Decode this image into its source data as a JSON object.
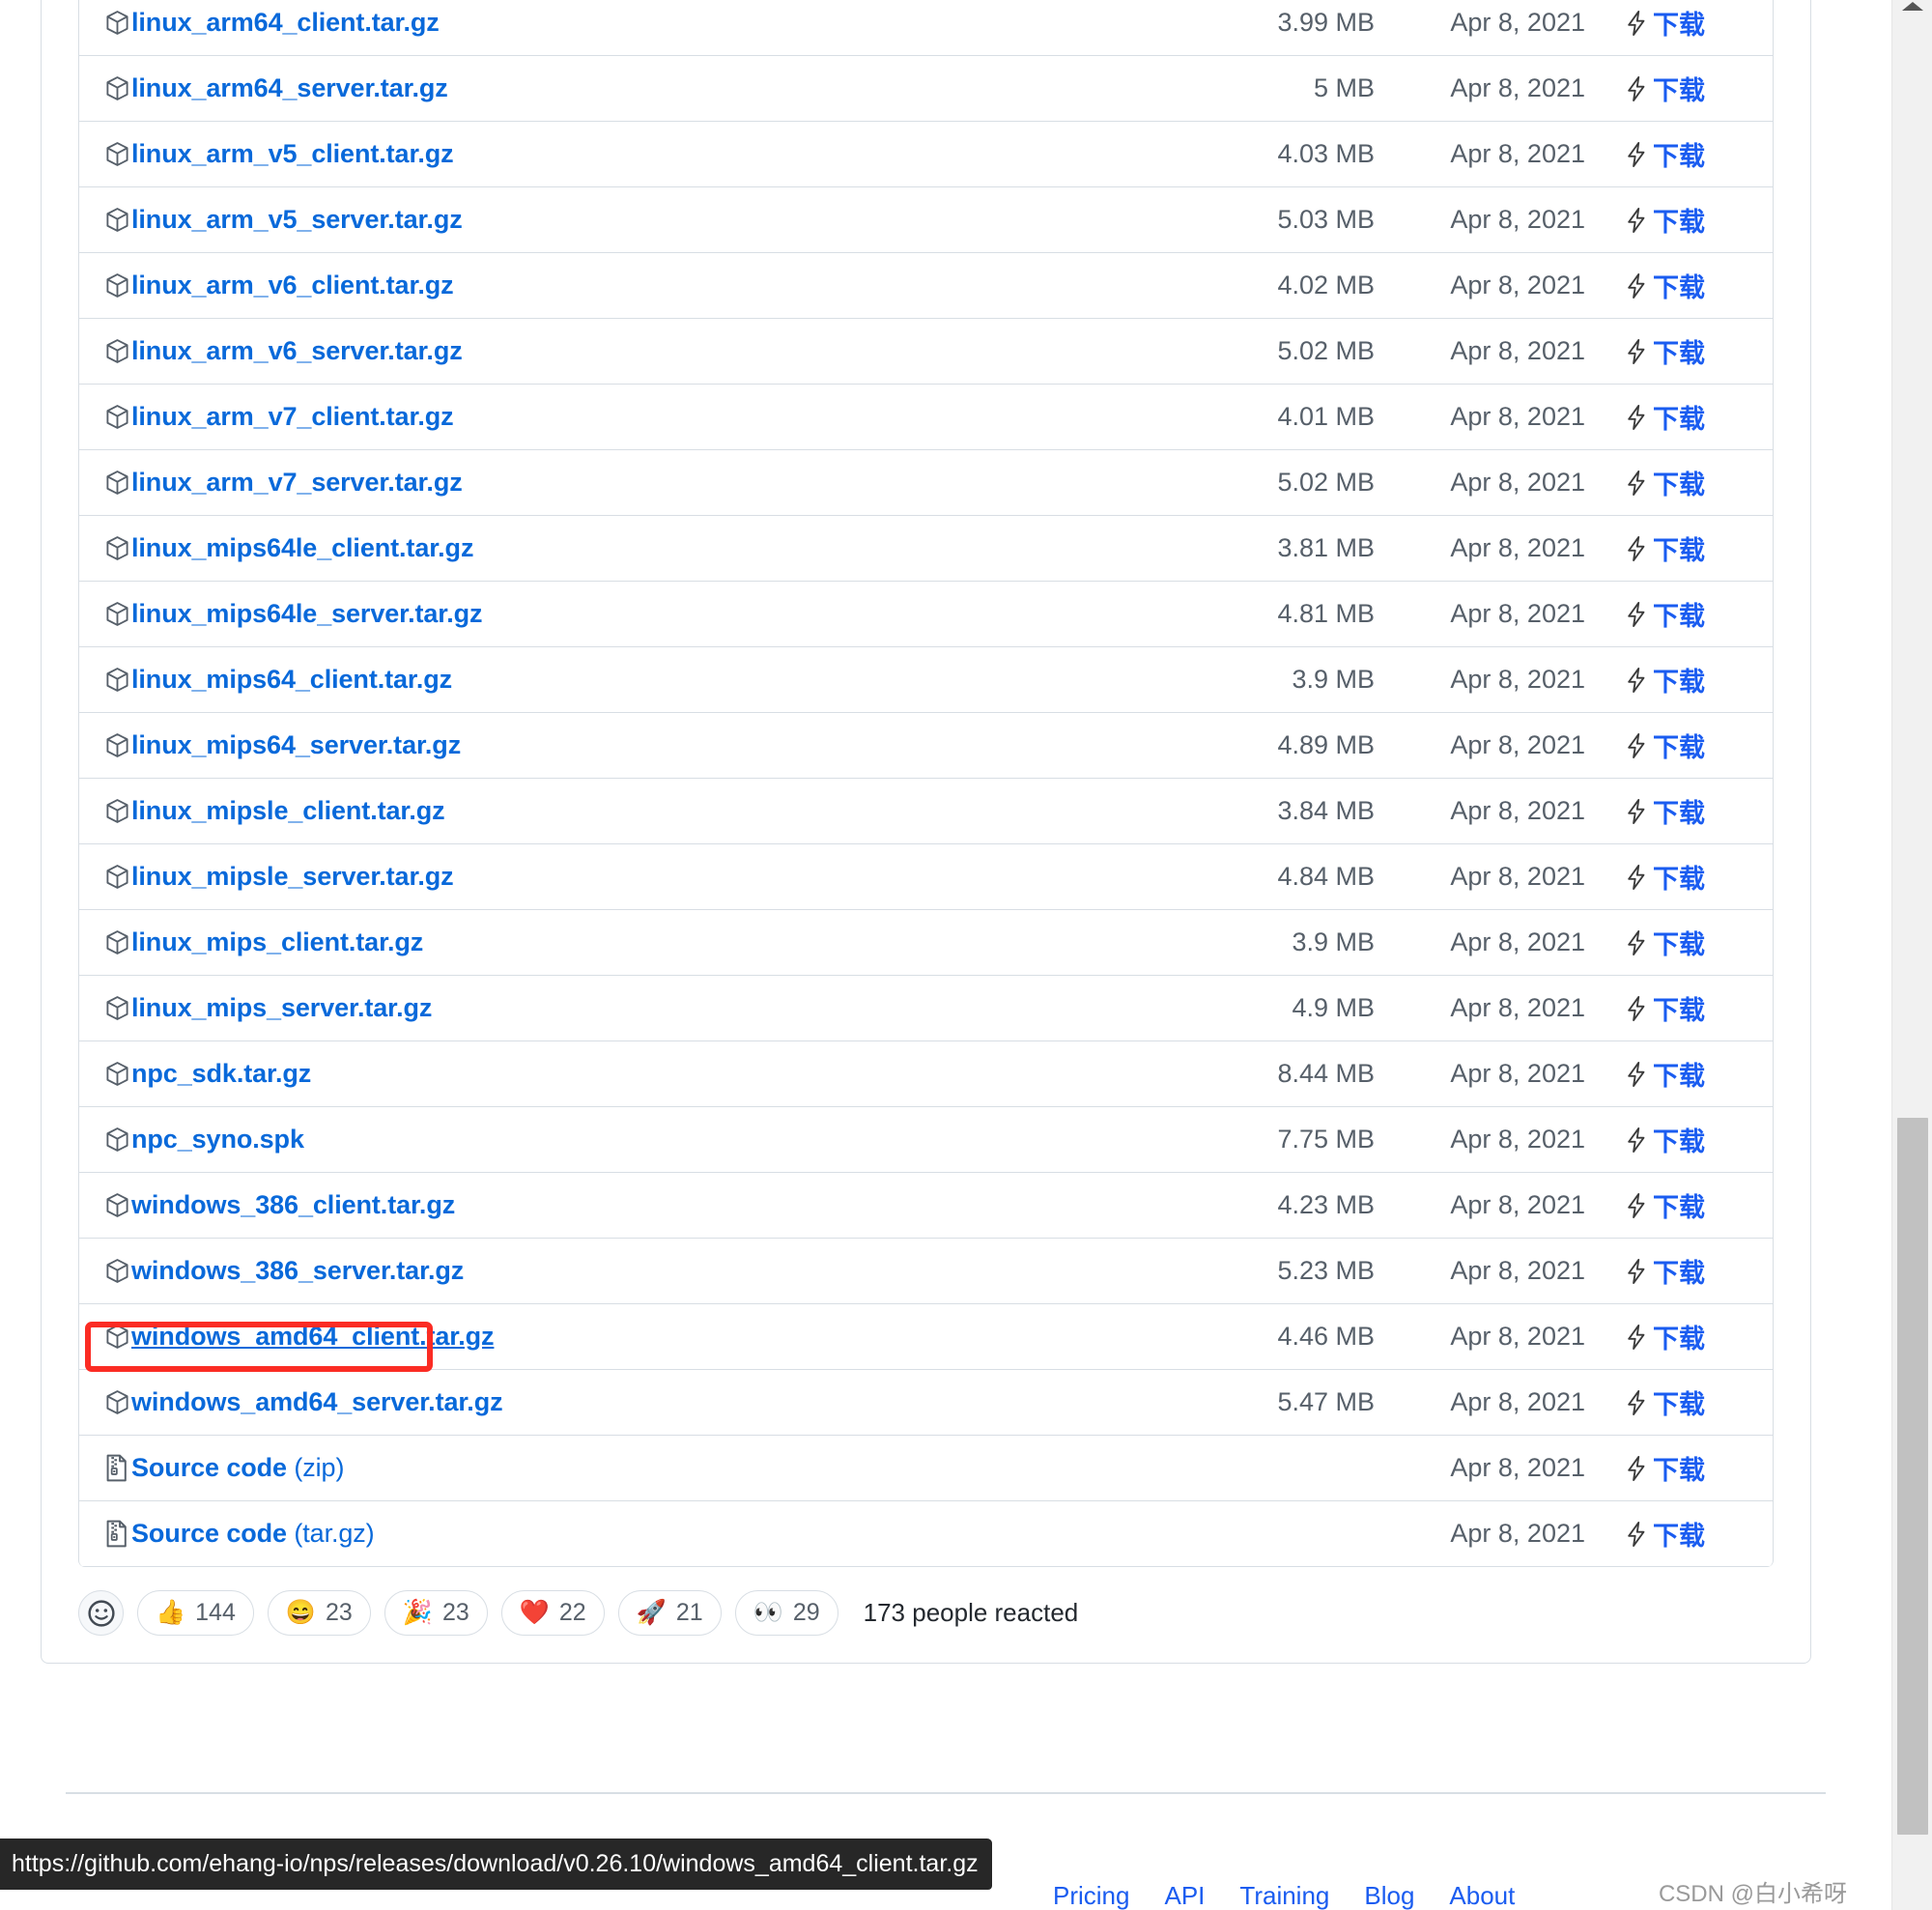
{
  "assets": {
    "columns": [
      "name",
      "size",
      "date",
      "download"
    ],
    "download_label": "下载",
    "rows": [
      {
        "name": "linux_arm64_client.tar.gz",
        "size": "3.99 MB",
        "date": "Apr 8, 2021"
      },
      {
        "name": "linux_arm64_server.tar.gz",
        "size": "5 MB",
        "date": "Apr 8, 2021"
      },
      {
        "name": "linux_arm_v5_client.tar.gz",
        "size": "4.03 MB",
        "date": "Apr 8, 2021"
      },
      {
        "name": "linux_arm_v5_server.tar.gz",
        "size": "5.03 MB",
        "date": "Apr 8, 2021"
      },
      {
        "name": "linux_arm_v6_client.tar.gz",
        "size": "4.02 MB",
        "date": "Apr 8, 2021"
      },
      {
        "name": "linux_arm_v6_server.tar.gz",
        "size": "5.02 MB",
        "date": "Apr 8, 2021"
      },
      {
        "name": "linux_arm_v7_client.tar.gz",
        "size": "4.01 MB",
        "date": "Apr 8, 2021"
      },
      {
        "name": "linux_arm_v7_server.tar.gz",
        "size": "5.02 MB",
        "date": "Apr 8, 2021"
      },
      {
        "name": "linux_mips64le_client.tar.gz",
        "size": "3.81 MB",
        "date": "Apr 8, 2021"
      },
      {
        "name": "linux_mips64le_server.tar.gz",
        "size": "4.81 MB",
        "date": "Apr 8, 2021"
      },
      {
        "name": "linux_mips64_client.tar.gz",
        "size": "3.9 MB",
        "date": "Apr 8, 2021"
      },
      {
        "name": "linux_mips64_server.tar.gz",
        "size": "4.89 MB",
        "date": "Apr 8, 2021"
      },
      {
        "name": "linux_mipsle_client.tar.gz",
        "size": "3.84 MB",
        "date": "Apr 8, 2021"
      },
      {
        "name": "linux_mipsle_server.tar.gz",
        "size": "4.84 MB",
        "date": "Apr 8, 2021"
      },
      {
        "name": "linux_mips_client.tar.gz",
        "size": "3.9 MB",
        "date": "Apr 8, 2021"
      },
      {
        "name": "linux_mips_server.tar.gz",
        "size": "4.9 MB",
        "date": "Apr 8, 2021"
      },
      {
        "name": "npc_sdk.tar.gz",
        "size": "8.44 MB",
        "date": "Apr 8, 2021"
      },
      {
        "name": "npc_syno.spk",
        "size": "7.75 MB",
        "date": "Apr 8, 2021"
      },
      {
        "name": "windows_386_client.tar.gz",
        "size": "4.23 MB",
        "date": "Apr 8, 2021"
      },
      {
        "name": "windows_386_server.tar.gz",
        "size": "5.23 MB",
        "date": "Apr 8, 2021"
      },
      {
        "name": "windows_amd64_client.tar.gz",
        "size": "4.46 MB",
        "date": "Apr 8, 2021",
        "highlighted": true
      },
      {
        "name": "windows_amd64_server.tar.gz",
        "size": "5.47 MB",
        "date": "Apr 8, 2021"
      },
      {
        "name": "Source code",
        "suffix": " (zip)",
        "size": "",
        "date": "Apr 8, 2021",
        "kind": "source"
      },
      {
        "name": "Source code",
        "suffix": " (tar.gz)",
        "size": "",
        "date": "Apr 8, 2021",
        "kind": "source"
      }
    ]
  },
  "reactions": {
    "add_label": "add-reaction",
    "items": [
      {
        "emoji": "👍",
        "count": "144",
        "name": "thumbs-up"
      },
      {
        "emoji": "😄",
        "count": "23",
        "name": "laugh"
      },
      {
        "emoji": "🎉",
        "count": "23",
        "name": "hooray"
      },
      {
        "emoji": "❤️",
        "count": "22",
        "name": "heart"
      },
      {
        "emoji": "🚀",
        "count": "21",
        "name": "rocket"
      },
      {
        "emoji": "👀",
        "count": "29",
        "name": "eyes"
      }
    ],
    "summary": "173 people reacted"
  },
  "footer": {
    "links": [
      "Pricing",
      "API",
      "Training",
      "Blog",
      "About"
    ]
  },
  "status_bar": {
    "url": "https://github.com/ehang-io/nps/releases/download/v0.26.10/windows_amd64_client.tar.gz"
  },
  "watermark": {
    "text": "CSDN @白小希呀"
  },
  "colors": {
    "link": "#0969da",
    "download_link": "#1a5cf0",
    "muted_text": "#57606a",
    "border": "#d8dee4",
    "annotation_red": "#fb2c24",
    "status_bar_bg": "#272727"
  }
}
